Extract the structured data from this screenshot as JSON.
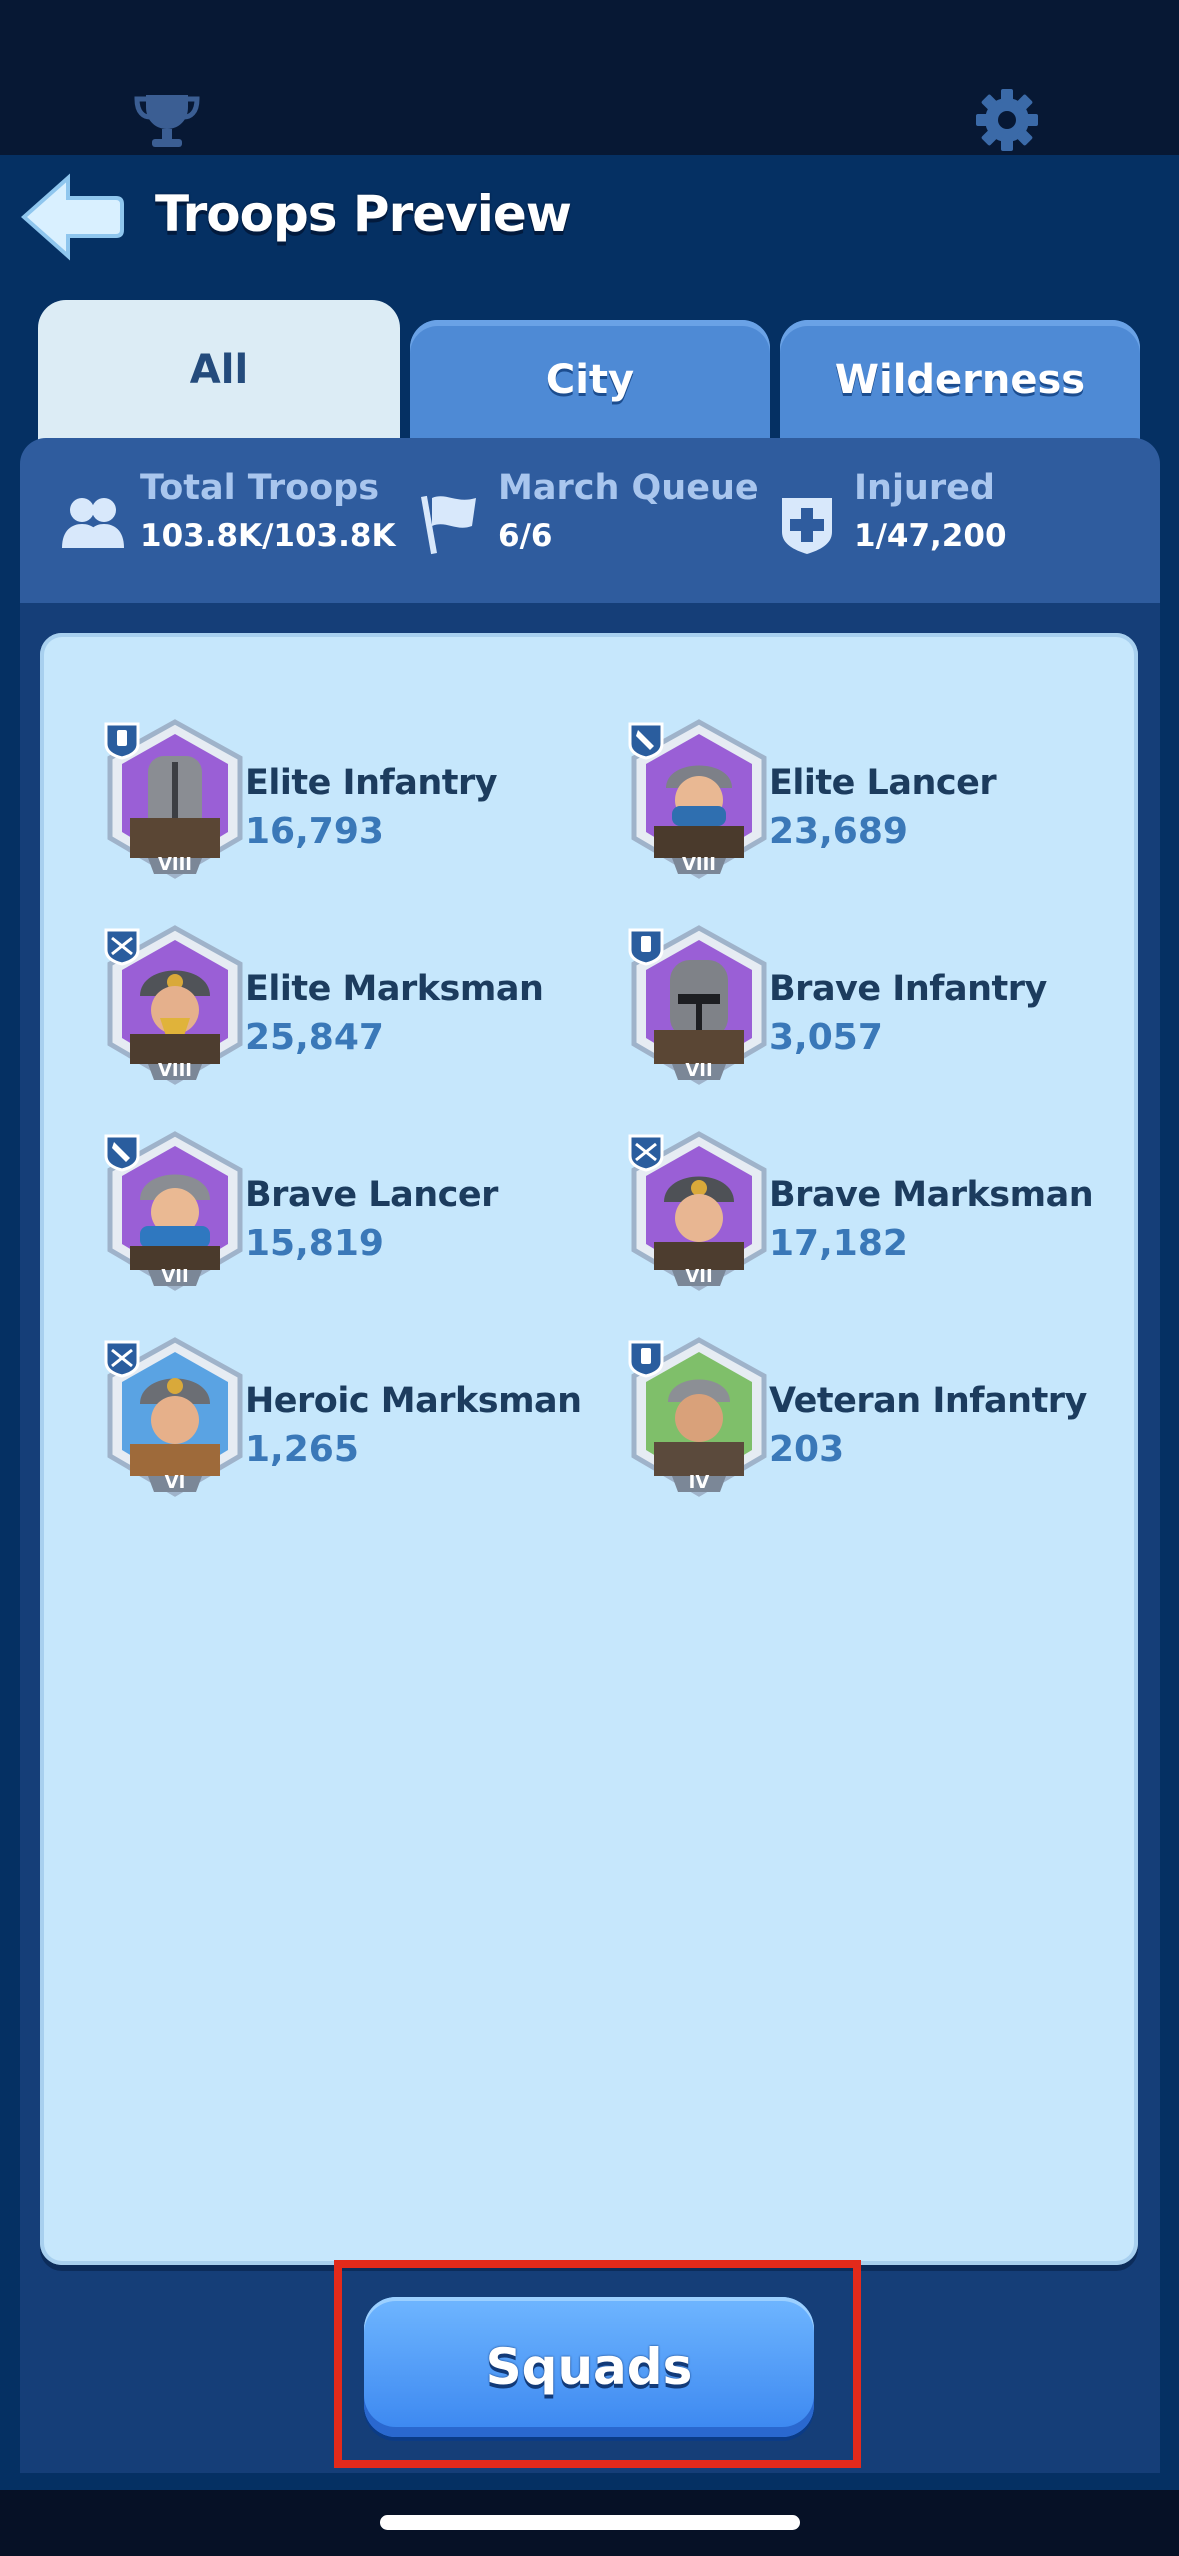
{
  "header": {
    "title": "Troops Preview",
    "icons": {
      "trophy": "trophy-icon",
      "settings": "gear-icon",
      "back": "back-arrow-icon"
    }
  },
  "tabs": [
    {
      "label": "All",
      "active": true
    },
    {
      "label": "City",
      "active": false
    },
    {
      "label": "Wilderness",
      "active": false
    }
  ],
  "stats": {
    "total_troops": {
      "label": "Total Troops",
      "value": "103.8K/103.8K",
      "icon": "people-icon"
    },
    "march_queue": {
      "label": "March Queue",
      "value": "6/6",
      "icon": "flag-icon"
    },
    "injured": {
      "label": "Injured",
      "value": "1/47,200",
      "icon": "medical-cross-icon"
    }
  },
  "troops": [
    {
      "name": "Elite Infantry",
      "count": "16,793",
      "tier": "VIII",
      "type": "infantry"
    },
    {
      "name": "Elite Lancer",
      "count": "23,689",
      "tier": "VIII",
      "type": "lancer"
    },
    {
      "name": "Elite Marksman",
      "count": "25,847",
      "tier": "VIII",
      "type": "marksman"
    },
    {
      "name": "Brave Infantry",
      "count": "3,057",
      "tier": "VII",
      "type": "infantry"
    },
    {
      "name": "Brave Lancer",
      "count": "15,819",
      "tier": "VII",
      "type": "lancer"
    },
    {
      "name": "Brave Marksman",
      "count": "17,182",
      "tier": "VII",
      "type": "marksman"
    },
    {
      "name": "Heroic Marksman",
      "count": "1,265",
      "tier": "VI",
      "type": "marksman"
    },
    {
      "name": "Veteran Infantry",
      "count": "203",
      "tier": "IV",
      "type": "infantry"
    }
  ],
  "footer": {
    "squads_label": "Squads"
  },
  "colors": {
    "background": "#053063",
    "panel": "#c6e7fc",
    "tab_active": "#dcecf5",
    "tab_inactive": "#4e8ad5",
    "button": "#4a9af7",
    "highlight": "#e32a1b"
  }
}
